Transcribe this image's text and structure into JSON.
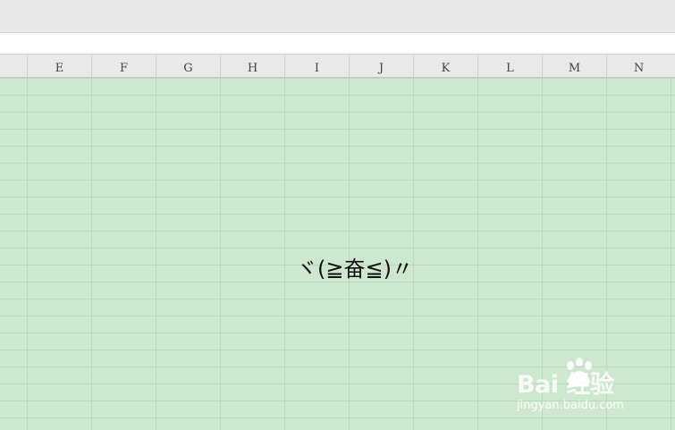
{
  "columns": [
    "E",
    "F",
    "G",
    "H",
    "I",
    "J",
    "K",
    "L",
    "M",
    "N"
  ],
  "cell": {
    "text": "ヾ(≧奋≦)〃"
  },
  "watermark": {
    "logo": "Bai 经验",
    "url": "jingyan.baidu.com"
  },
  "colors": {
    "grid_fill": "#cde8cf",
    "header_bg": "#e9e9e9",
    "toolbar_bg": "#e8e8e8"
  }
}
